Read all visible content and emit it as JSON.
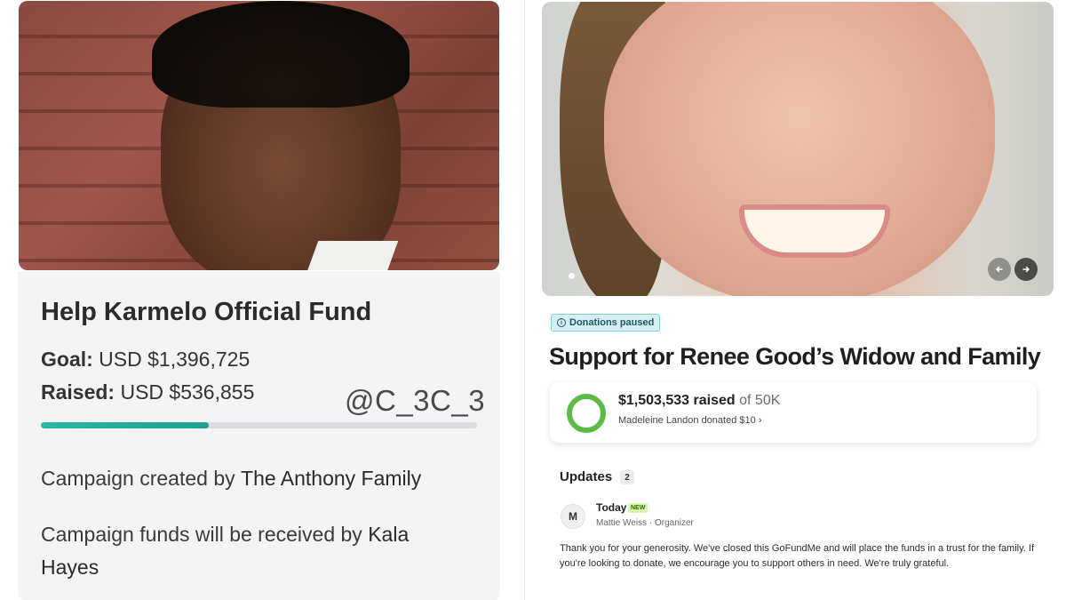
{
  "left_campaign": {
    "title": "Help Karmelo Official Fund",
    "goal_label": "Goal:",
    "goal_value": "USD $1,396,725",
    "raised_label": "Raised:",
    "raised_value": "USD $536,855",
    "watermark": "@C_3C_3",
    "progress_fraction": 0.384,
    "created_prefix": "Campaign created by",
    "created_by": "The Anthony Family",
    "received_prefix": "Campaign funds will be received by",
    "received_by": "Kala Hayes"
  },
  "right_campaign": {
    "status_badge": "Donations paused",
    "title": "Support for Renee Good’s Widow and Family",
    "raised_amount": "$1,503,533 raised",
    "goal_suffix": "of 50K",
    "latest_donation": "Madeleine Landon donated $10",
    "updates_label": "Updates",
    "updates_count": "2",
    "update": {
      "avatar_letter": "M",
      "date": "Today",
      "new_label": "NEW",
      "author": "Mattie Weiss",
      "role": "Organizer",
      "separator": "·",
      "body": "Thank you for your generosity. We've closed this GoFundMe and will place the funds in a trust for the family. If you're looking to donate, we encourage you to support others in need. We're truly grateful."
    },
    "nav": {
      "prev_icon": "arrow-left-icon",
      "next_icon": "arrow-right-icon"
    }
  },
  "colors": {
    "progress_teal": "#2fb7a3",
    "ring_green": "#5dbb45",
    "badge_bg": "#d4f0f2",
    "new_badge_bg": "#d8f5b0"
  }
}
